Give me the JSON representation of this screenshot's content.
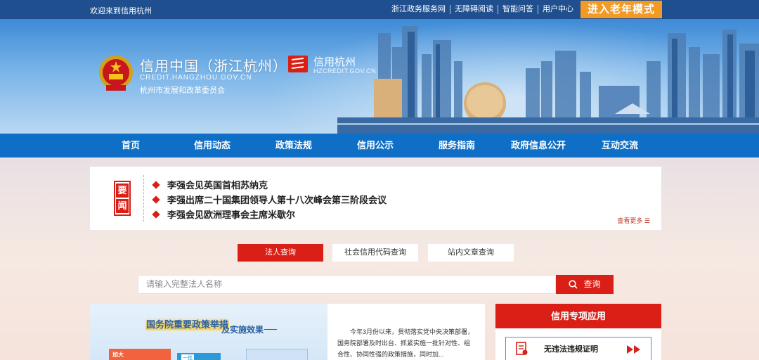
{
  "topbar": {
    "welcome": "欢迎来到信用杭州",
    "links": [
      "浙江政务服务网",
      "无障碍阅读",
      "智能问答",
      "用户中心"
    ],
    "elder_mode": "进入老年模式"
  },
  "header": {
    "title": "信用中国（浙江杭州）",
    "domain": "CREDIT.HANGZHOU.GOV.CN",
    "org": "杭州市发展和改革委员会",
    "brand_name": "信用杭州",
    "brand_domain": "HZCREDIT.GOV.CN"
  },
  "nav": [
    "首页",
    "信用动态",
    "政策法规",
    "信用公示",
    "服务指南",
    "政府信息公开",
    "互动交流"
  ],
  "news": {
    "badge": [
      "要",
      "闻"
    ],
    "items": [
      "李强会见英国首相苏纳克",
      "李强出席二十国集团领导人第十八次峰会第三阶段会议",
      "李强会见欧洲理事会主席米歇尔"
    ],
    "more": "查看更多 ☰"
  },
  "search": {
    "tabs": [
      "法人查询",
      "社会信用代码查询",
      "站内文章查询"
    ],
    "active_tab": 0,
    "placeholder": "请输入完整法人名称",
    "button": "查询"
  },
  "policy": {
    "title_a": "国务院重要政策举措",
    "title_b": "及实施效果",
    "card_label": "加大",
    "card_label_2": "一批",
    "text": "今年3月份以来，贯彻落实党中央决策部署，国务院部署及时出台、抓紧实施一批针对性、组合性、协同性强的政策措施，同时加..."
  },
  "special": {
    "title": "信用专项应用",
    "entry": "无违法违规证明"
  },
  "colors": {
    "nav_blue": "#0f6fc6",
    "accent_red": "#d91f16",
    "elder_orange": "#f29a24"
  }
}
